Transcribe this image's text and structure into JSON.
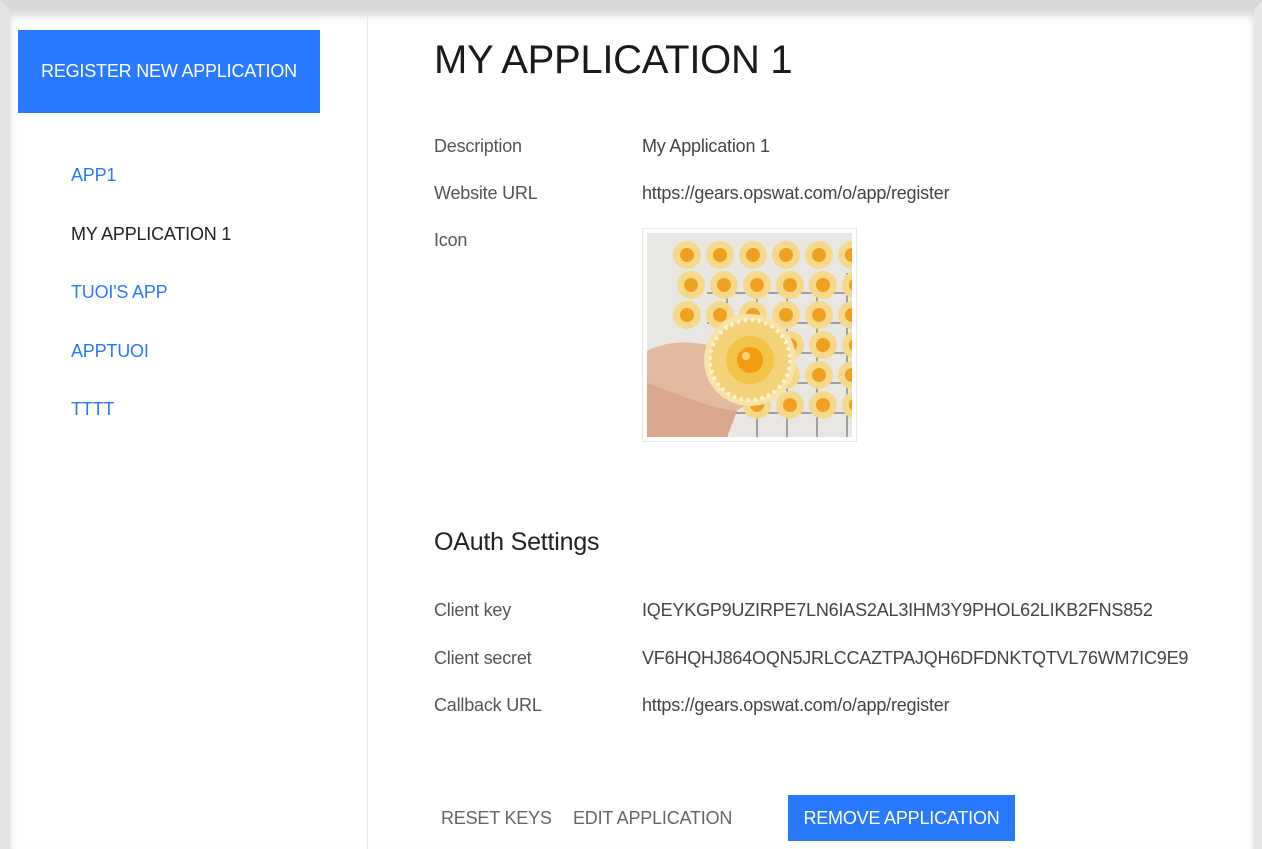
{
  "sidebar": {
    "register_label": "REGISTER NEW APPLICATION",
    "apps": [
      {
        "label": "APP1"
      },
      {
        "label": "MY APPLICATION 1"
      },
      {
        "label": "TUOI'S APP"
      },
      {
        "label": "APPTUOI"
      },
      {
        "label": "TTTT"
      }
    ],
    "active_index": 1
  },
  "main": {
    "title": "MY APPLICATION 1",
    "details": {
      "description_label": "Description",
      "description_value": "My Application 1",
      "website_label": "Website URL",
      "website_value": "https://gears.opswat.com/o/app/register",
      "icon_label": "Icon"
    },
    "oauth": {
      "title": "OAuth Settings",
      "client_key_label": "Client key",
      "client_key_value": "IQEYKGP9UZIRPE7LN6IAS2AL3IHM3Y9PHOL62LIKB2FNS852",
      "client_secret_label": "Client secret",
      "client_secret_value": "VF6HQHJ864OQN5JRLCCAZTPAJQH6DFDNKTQTVL76WM7IC9E9",
      "callback_label": "Callback URL",
      "callback_value": "https://gears.opswat.com/o/app/register"
    },
    "actions": {
      "reset_label": "RESET KEYS",
      "edit_label": "EDIT APPLICATION",
      "remove_label": "REMOVE APPLICATION"
    }
  },
  "colors": {
    "accent": "#2979ff",
    "active_text": "#222222",
    "label_text": "#555555"
  }
}
